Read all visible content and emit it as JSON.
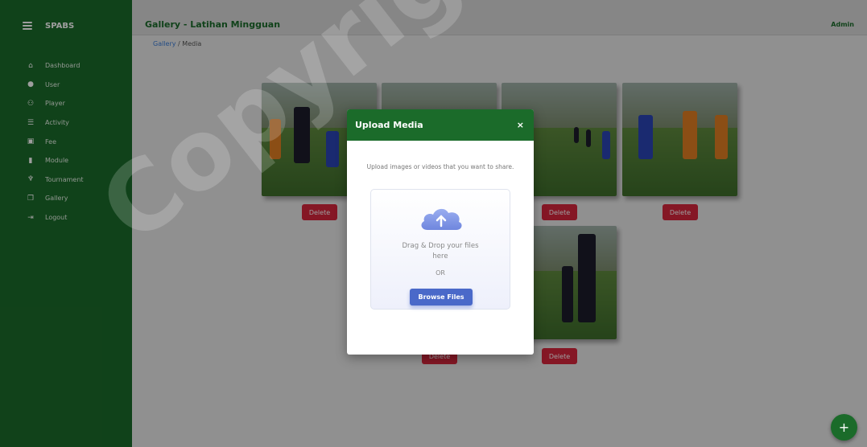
{
  "app": {
    "name": "SPABS"
  },
  "header": {
    "title": "Gallery - Latihan Mingguan",
    "user": "Admin"
  },
  "breadcrumb": {
    "parent": "Gallery",
    "separator": "/",
    "current": "Media"
  },
  "sidebar": {
    "items": [
      {
        "label": "Dashboard",
        "icon": "home-icon"
      },
      {
        "label": "User",
        "icon": "user-icon"
      },
      {
        "label": "Player",
        "icon": "players-icon"
      },
      {
        "label": "Activity",
        "icon": "list-icon"
      },
      {
        "label": "Fee",
        "icon": "money-icon"
      },
      {
        "label": "Module",
        "icon": "book-icon"
      },
      {
        "label": "Tournament",
        "icon": "trophy-icon"
      },
      {
        "label": "Gallery",
        "icon": "images-icon"
      },
      {
        "label": "Logout",
        "icon": "logout-icon"
      }
    ]
  },
  "gallery": {
    "delete_label": "Delete"
  },
  "modal": {
    "title": "Upload Media",
    "close": "×",
    "description": "Upload images or videos that you want to share.",
    "drop_text": "Drag & Drop your files here",
    "or_text": "OR",
    "browse_label": "Browse Files"
  },
  "fab": {
    "label": "+"
  },
  "watermark": "Copyright UKM",
  "colors": {
    "primary": "#1b6b2a",
    "danger": "#d7263d",
    "accent": "#4a69c9"
  }
}
